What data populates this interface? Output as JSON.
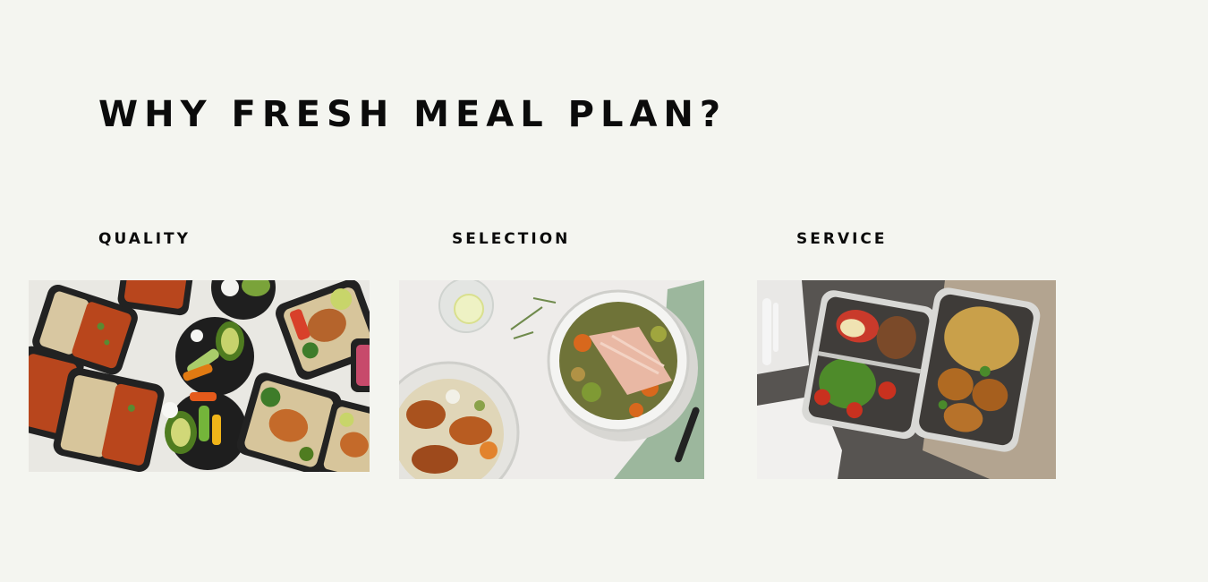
{
  "section": {
    "title": "WHY FRESH MEAL PLAN?"
  },
  "features": [
    {
      "label": "QUALITY",
      "image": "meal-prep-containers-photo"
    },
    {
      "label": "SELECTION",
      "image": "salmon-bowl-photo"
    },
    {
      "label": "SERVICE",
      "image": "lunchbox-photo"
    }
  ],
  "colors": {
    "background": "#f4f5f0",
    "text": "#0b0b0b"
  }
}
